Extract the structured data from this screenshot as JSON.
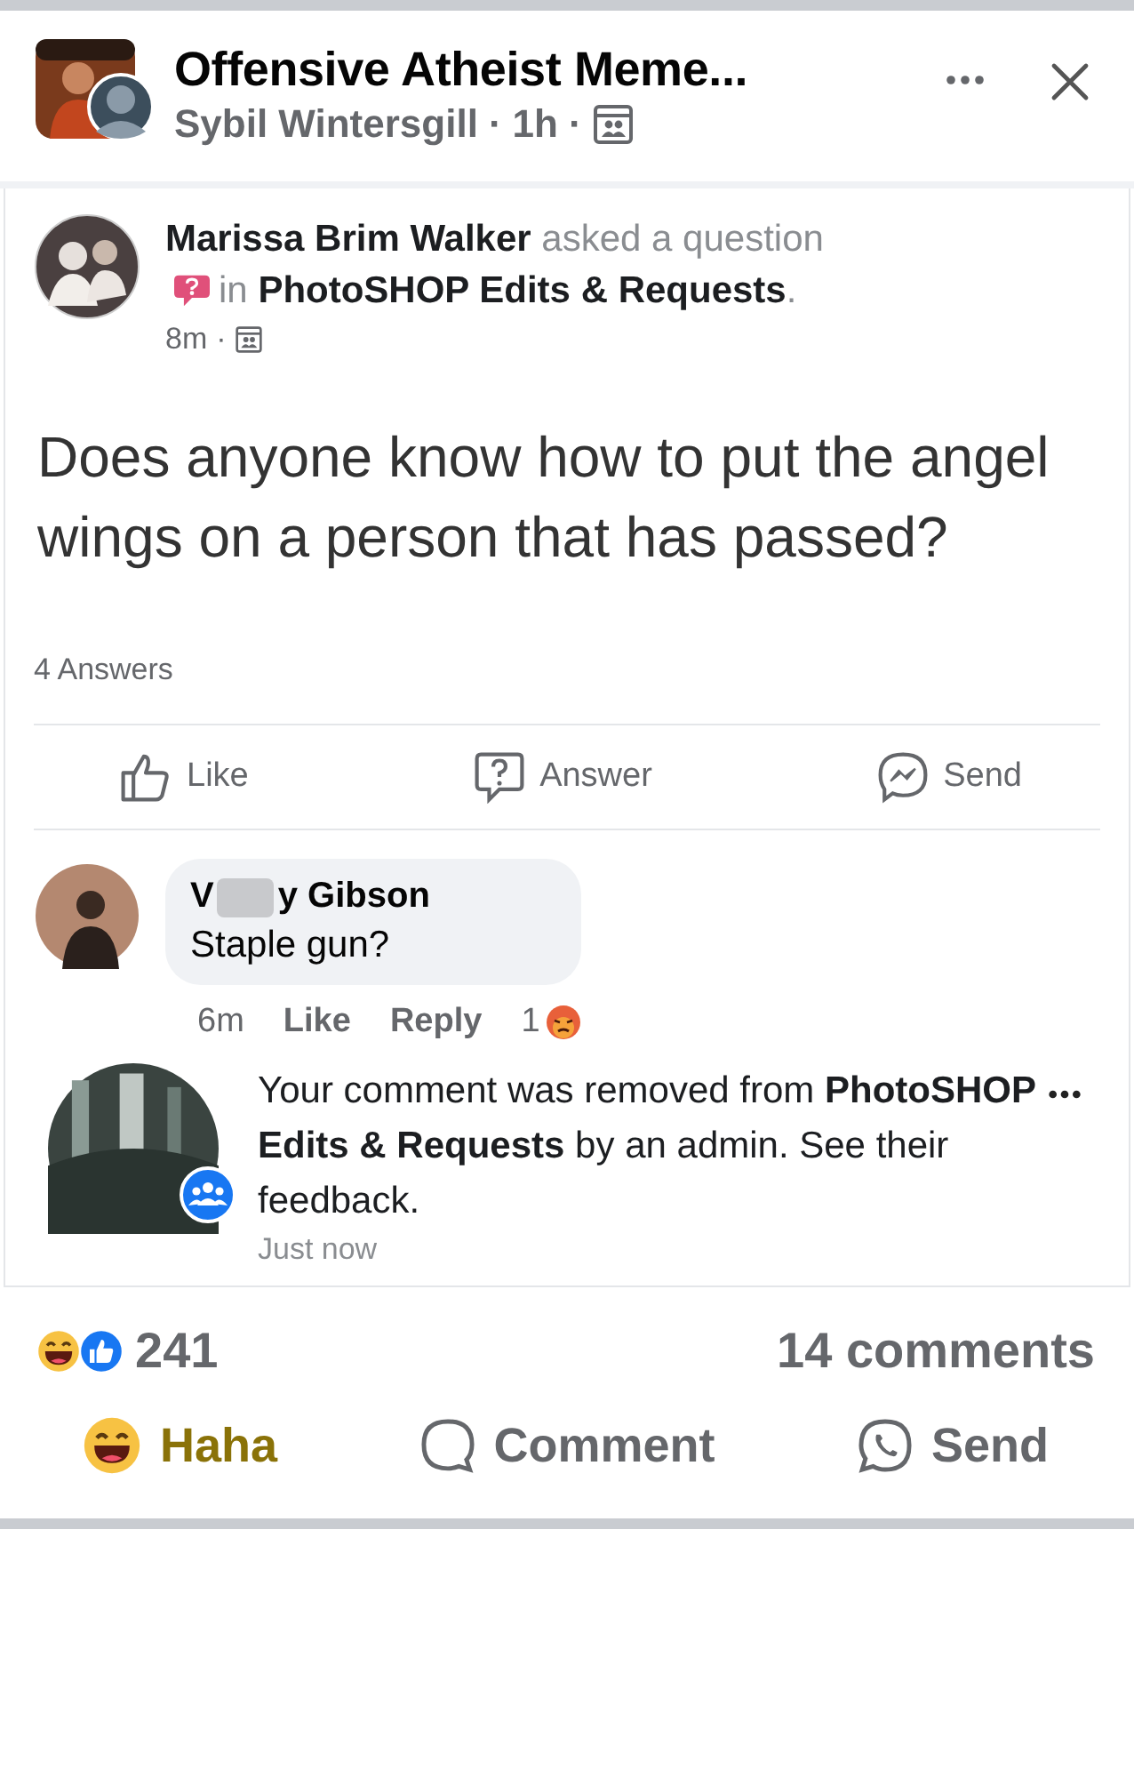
{
  "header": {
    "title": "Offensive Atheist Meme...",
    "author": "Sybil Wintersgill",
    "separator": "·",
    "time": "1h"
  },
  "shared_post": {
    "intro_start": "**Marissa Brim Walker** asked a question",
    "intro_end": "in **PhotoSHOP Edits & Requests**.",
    "time": "8m",
    "separator": "·",
    "question": "Does anyone know how to put the angel wings on a person that has passed?",
    "answers_count": "4 Answers",
    "actions": [
      {
        "label": "Like",
        "kind": "like"
      },
      {
        "label": "Answer",
        "kind": "answer"
      },
      {
        "label": "Send",
        "kind": "messenger"
      }
    ],
    "comment": {
      "name_start": "V",
      "name_end": "y Gibson",
      "text": "Staple gun?",
      "time": "6m",
      "like": "Like",
      "reply": "Reply",
      "reaction_count": "1"
    },
    "notice": {
      "text": "Your comment was removed from **PhotoSHOP Edits & Requests** by an admin. See their feedback.",
      "time": "Just now"
    }
  },
  "footer": {
    "reaction_count": "241",
    "comments_count": "14 comments",
    "actions": [
      {
        "label": "Haha",
        "kind": "haha",
        "selected": true
      },
      {
        "label": "Comment",
        "kind": "comment",
        "selected": false
      },
      {
        "label": "Send",
        "kind": "whatsapp",
        "selected": false
      }
    ]
  }
}
